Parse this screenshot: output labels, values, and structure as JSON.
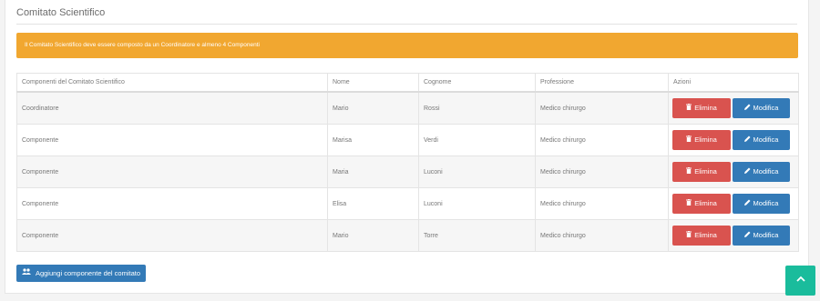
{
  "panel": {
    "title": "Comitato Scientifico"
  },
  "alert": {
    "text": "Il Comitato Scientifico deve essere composto da un Coordinatore e almeno 4 Componenti"
  },
  "table": {
    "headers": [
      "Componenti del Comitato Scientifico",
      "Nome",
      "Cognome",
      "Professione",
      "Azioni"
    ],
    "rows": [
      {
        "role": "Coordinatore",
        "nome": "Mario",
        "cognome": "Rossi",
        "professione": "Medico chirurgo"
      },
      {
        "role": "Componente",
        "nome": "Marisa",
        "cognome": "Verdi",
        "professione": "Medico chirurgo"
      },
      {
        "role": "Componente",
        "nome": "Maria",
        "cognome": "Luconi",
        "professione": "Medico chirurgo"
      },
      {
        "role": "Componente",
        "nome": "Elisa",
        "cognome": "Luconi",
        "professione": "Medico chirurgo"
      },
      {
        "role": "Componente",
        "nome": "Mario",
        "cognome": "Torre",
        "professione": "Medico chirurgo"
      }
    ],
    "delete_label": "Elimina",
    "edit_label": "Modifica"
  },
  "add_button": {
    "label": "Aggiungi componente del comitato"
  },
  "colors": {
    "alert": "#f1a730",
    "danger": "#d9534f",
    "primary": "#337ab7",
    "scroll_top": "#1abc9c"
  },
  "icons": {
    "delete": "trash-icon",
    "edit": "pencil-icon",
    "add": "users-icon",
    "scroll_top": "chevron-up-icon"
  }
}
